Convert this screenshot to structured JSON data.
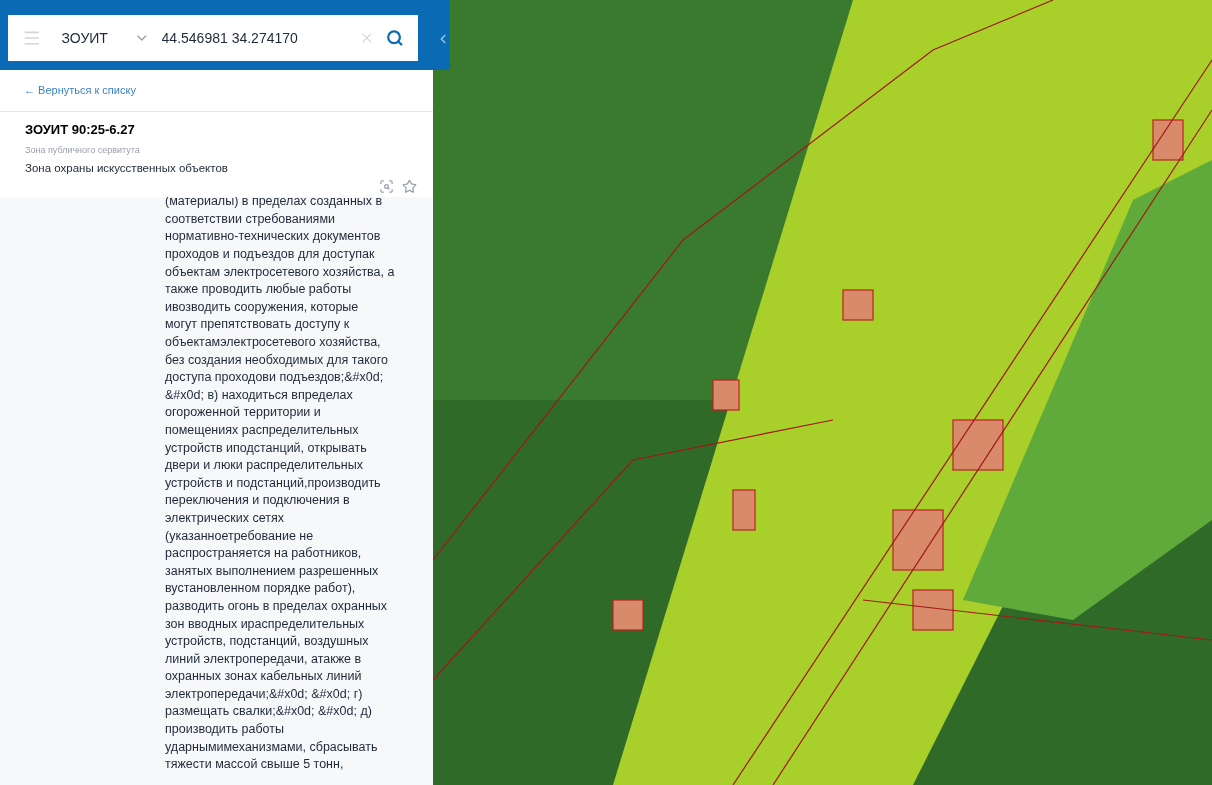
{
  "search": {
    "layer": "ЗОУИТ",
    "value": "44.546981 34.274170"
  },
  "back_link": "← Вернуться к списку",
  "object": {
    "title": "ЗОУИТ 90:25-6.27",
    "category": "Зона публичного сервитута",
    "name": "Зона охраны искусственных объектов"
  },
  "description_lines": [
    "(материалы) в пределах созданных в",
    "соответствии стребованиями",
    "нормативно-технических документов",
    "проходов и подъездов для доступак",
    "объектам электросетевого хозяйства, а",
    "также проводить любые работы",
    "ивозводить сооружения, которые",
    "могут препятствовать доступу к",
    "объектамэлектросетевого хозяйства,",
    "без создания необходимых для такого",
    "доступа проходови подъездов;&#x0d;",
    "&#x0d; в) находиться впределах",
    "огороженной территории и",
    "помещениях распределительных",
    "устройств иподстанций, открывать",
    "двери и люки распределительных",
    "устройств и подстанций,производить",
    "переключения и подключения в",
    "электрических сетях",
    "(указанноетребование не",
    "распространяется на работников,",
    "занятых выполнением разрешенных",
    "вустановленном порядке работ),",
    "разводить огонь в пределах охранных",
    "зон вводных ираспределительных",
    "устройств, подстанций, воздушных",
    "линий электропередачи, атакже в",
    "охранных зонах кабельных линий",
    "электропередачи;&#x0d; &#x0d; г)",
    "размещать свалки;&#x0d; &#x0d; д)",
    "производить работы",
    "ударнымимеханизмами, сбрасывать",
    "тяжести массой свыше 5 тонн,"
  ]
}
